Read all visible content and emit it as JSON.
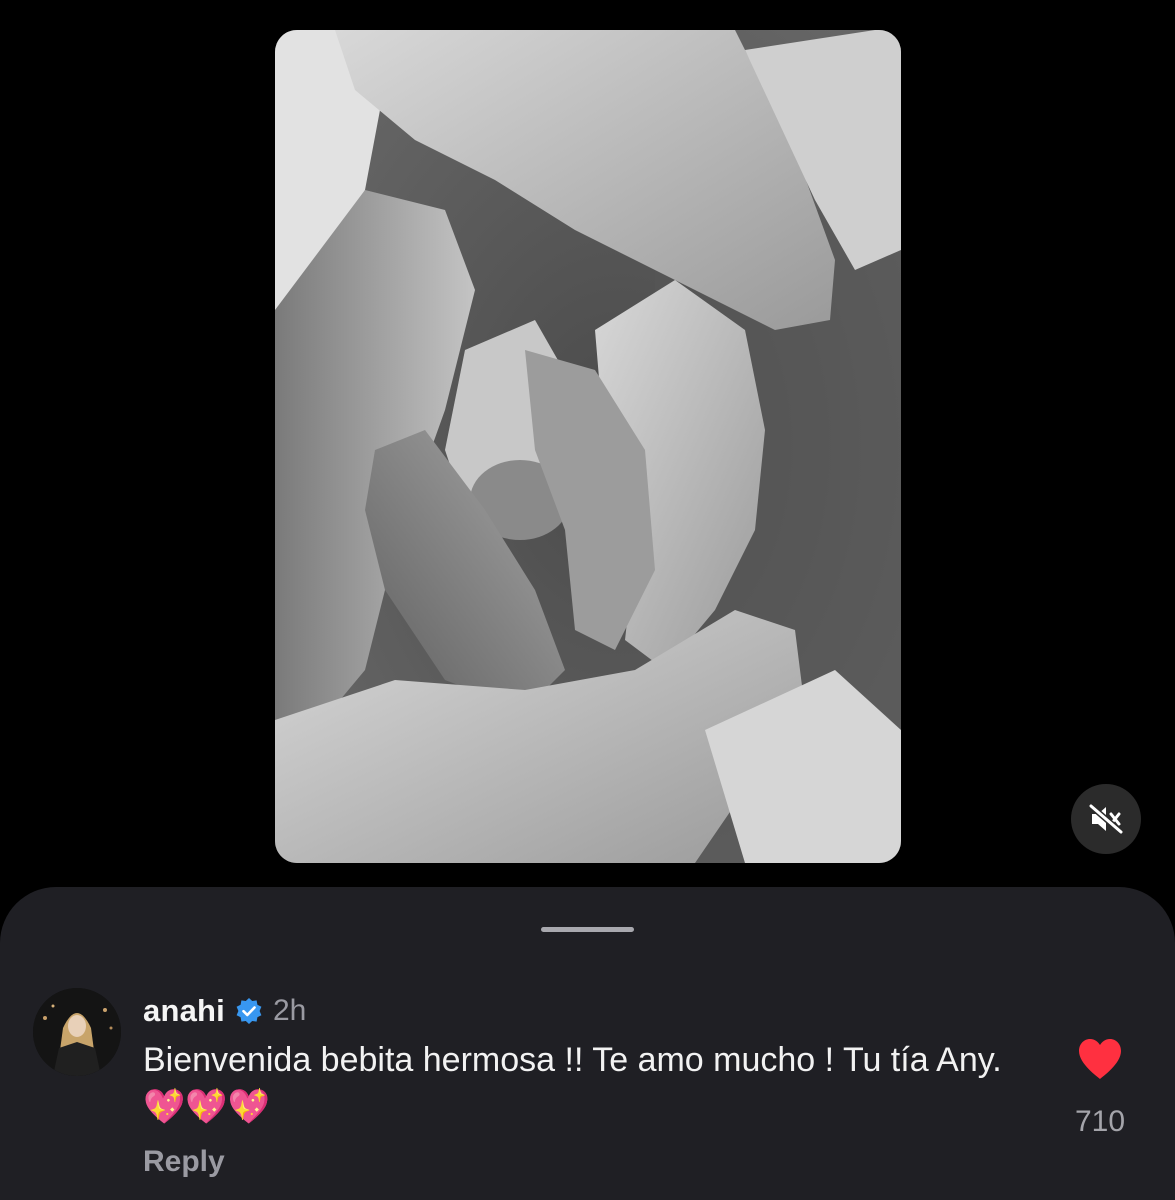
{
  "colors": {
    "background": "#000000",
    "sheet": "#1f1f24",
    "verified": "#3897f0",
    "like": "#ff3040",
    "secondary_text": "#9a9aa2"
  },
  "media": {
    "description_icon": "photo-grayscale",
    "mute_icon": "speaker-muted-icon"
  },
  "comment": {
    "username": "anahi",
    "verified": true,
    "time": "2h",
    "text": "Bienvenida bebita hermosa !! Te amo mucho ! Tu tía Any. 💖💖💖",
    "reply_label": "Reply",
    "like_count": "710",
    "liked": true
  }
}
